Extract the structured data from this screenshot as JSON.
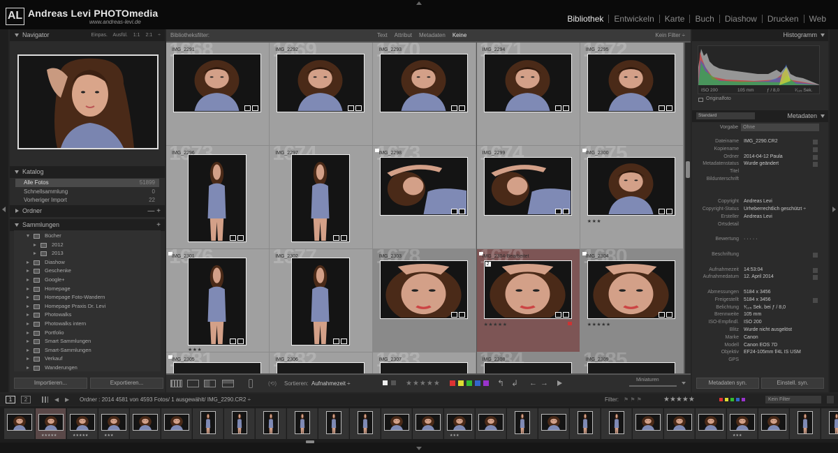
{
  "brand": {
    "logo": "AL",
    "name": "Andreas Levi PHOTOmedia",
    "url": "www.andreas-levi.de"
  },
  "modules": [
    {
      "label": "Bibliothek",
      "active": true
    },
    {
      "label": "Entwickeln"
    },
    {
      "label": "Karte"
    },
    {
      "label": "Buch"
    },
    {
      "label": "Diashow"
    },
    {
      "label": "Drucken"
    },
    {
      "label": "Web"
    }
  ],
  "navigator": {
    "title": "Navigator",
    "options": "Einpas.  Ausfül.  1:1  2:1 ÷"
  },
  "catalog": {
    "title": "Katalog",
    "items": [
      {
        "label": "Alle Fotos",
        "count": "51899"
      },
      {
        "label": "Schnellsammlung",
        "count": "0"
      },
      {
        "label": "Vorheriger Import",
        "count": "22"
      }
    ]
  },
  "folders": {
    "title": "Ordner",
    "actions": "— +"
  },
  "collections": {
    "title": "Sammlungen",
    "plus": "+",
    "items": [
      {
        "label": "Bücher",
        "level": 0,
        "open": true
      },
      {
        "label": "2012",
        "level": 1
      },
      {
        "label": "2013",
        "level": 1
      },
      {
        "label": "Diashow",
        "level": 0
      },
      {
        "label": "Geschenke",
        "level": 0
      },
      {
        "label": "Google+",
        "level": 0
      },
      {
        "label": "Homepage",
        "level": 0
      },
      {
        "label": "Homepage Foto-Wandern",
        "level": 0
      },
      {
        "label": "Homepage Praxis Dr. Levi",
        "level": 0
      },
      {
        "label": "Photowalks",
        "level": 0
      },
      {
        "label": "Photowalks intern",
        "level": 0
      },
      {
        "label": "Portfolio",
        "level": 0
      },
      {
        "label": "Smart Sammlungen",
        "level": 0
      },
      {
        "label": "Smart-Sammlungen",
        "level": 0
      },
      {
        "label": "Verkauf",
        "level": 0
      },
      {
        "label": "Wanderungen",
        "level": 0
      }
    ]
  },
  "left_buttons": {
    "import": "Importieren...",
    "export": "Exportieren..."
  },
  "filterbar": {
    "label": "Bibliotheksfilter:",
    "tabs": [
      {
        "label": "Text"
      },
      {
        "label": "Attribut"
      },
      {
        "label": "Metadaten"
      },
      {
        "label": "Keine",
        "active": true
      }
    ],
    "preset": "Kein Filter ÷"
  },
  "grid": [
    {
      "num": "1668",
      "name": "IMG_2291",
      "orient": "l",
      "flag": false
    },
    {
      "num": "1669",
      "name": "IMG_2292",
      "orient": "l",
      "flag": false
    },
    {
      "num": "1670",
      "name": "IMG_2293",
      "orient": "l",
      "flag": false
    },
    {
      "num": "1671",
      "name": "IMG_2294",
      "orient": "l",
      "flag": false
    },
    {
      "num": "1672",
      "name": "IMG_2295",
      "orient": "l",
      "flag": false
    },
    {
      "num": "1673",
      "name": "IMG_2296",
      "orient": "p",
      "flag": false
    },
    {
      "num": "1674",
      "name": "IMG_2297",
      "orient": "p",
      "flag": false
    },
    {
      "num": "1673",
      "name": "IMG_2298",
      "orient": "l",
      "flag": true
    },
    {
      "num": "1674",
      "name": "IMG_2299",
      "orient": "l",
      "flag": false
    },
    {
      "num": "1675",
      "name": "IMG_2300",
      "orient": "l",
      "flag": true,
      "stars": "★★★"
    },
    {
      "num": "1676",
      "name": "IMG_2301",
      "orient": "p",
      "flag": true,
      "stars": "★★★"
    },
    {
      "num": "1677",
      "name": "IMG_2302",
      "orient": "p",
      "flag": false
    },
    {
      "num": "1678",
      "name": "IMG_2303",
      "orient": "l",
      "flag": false,
      "dim": true
    },
    {
      "num": "1679",
      "name": "IMG_2304-Bearbeitet",
      "orient": "l",
      "flag": true,
      "sel": true,
      "stars": "★★★★★",
      "stack": "2"
    },
    {
      "num": "1680",
      "name": "IMG_2304",
      "orient": "l",
      "flag": true,
      "dim": true,
      "stars": "★★★★★"
    },
    {
      "num": "1681",
      "name": "IMG_2305",
      "orient": "l",
      "flag": true
    },
    {
      "num": "1682",
      "name": "IMG_2306",
      "orient": "l",
      "flag": false
    },
    {
      "num": "1683",
      "name": "IMG_2307",
      "orient": "l",
      "flag": false
    },
    {
      "num": "1684",
      "name": "IMG_2308",
      "orient": "l",
      "flag": false,
      "dim": true
    },
    {
      "num": "1685",
      "name": "IMG_2309",
      "orient": "l",
      "flag": false,
      "dim": true
    }
  ],
  "toolbar": {
    "sort_label": "Sortieren:",
    "sort_value": "Aufnahmezeit ÷",
    "stars": "★★★★★",
    "thumb_label": "Miniaturen",
    "colors": [
      "#d33",
      "#dd3",
      "#3b3",
      "#36c",
      "#93c"
    ]
  },
  "histogram": {
    "title": "Histogramm",
    "iso": "ISO 200",
    "focal": "105 mm",
    "aperture": "ƒ / 8,0",
    "shutter": "¹⁄₁₂₅ Sek.",
    "original": "Originalfoto"
  },
  "metadata": {
    "title": "Metadaten",
    "preset_select": "Standard",
    "preset_label": "Vorgabe",
    "preset_value": "Ohne",
    "rows": [
      {
        "k": "Dateiname",
        "v": "IMG_2290.CR2",
        "sq": true
      },
      {
        "k": "Kopiename",
        "v": "",
        "sq": true
      },
      {
        "k": "Ordner",
        "v": "2014-04-12 Paula",
        "sq": true
      },
      {
        "k": "Metadatenstatus",
        "v": "Wurde geändert",
        "sq": true
      },
      {
        "k": "Titel",
        "v": ""
      },
      {
        "k": "Bildunterschrift",
        "v": ""
      },
      {
        "k": "",
        "v": ""
      },
      {
        "k": "",
        "v": ""
      },
      {
        "k": "Copyright",
        "v": "Andreas Levi"
      },
      {
        "k": "Copyright-Status",
        "v": "Urheberrechtlich geschützt ÷"
      },
      {
        "k": "Ersteller",
        "v": "Andreas Levi"
      },
      {
        "k": "Ortsdetail",
        "v": ""
      },
      {
        "k": "",
        "v": ""
      },
      {
        "k": "Bewertung",
        "v": "·  ·  ·  ·  ·"
      },
      {
        "k": "",
        "v": ""
      },
      {
        "k": "Beschriftung",
        "v": "",
        "sq": true
      },
      {
        "k": "",
        "v": ""
      },
      {
        "k": "Aufnahmezeit",
        "v": "14:53:04",
        "sq": true
      },
      {
        "k": "Aufnahmedatum",
        "v": "12. April 2014",
        "sq": true
      },
      {
        "k": "",
        "v": ""
      },
      {
        "k": "Abmessungen",
        "v": "5184 x 3456"
      },
      {
        "k": "Freigestellt",
        "v": "5184 x 3456",
        "sq": true
      },
      {
        "k": "Belichtung",
        "v": "¹⁄₁₂₅ Sek. bei ƒ / 8,0"
      },
      {
        "k": "Brennweite",
        "v": "105 mm"
      },
      {
        "k": "ISO-Empfindl.",
        "v": "ISO 200"
      },
      {
        "k": "Blitz",
        "v": "Wurde nicht ausgelöst"
      },
      {
        "k": "Marke",
        "v": "Canon"
      },
      {
        "k": "Modell",
        "v": "Canon EOS 7D"
      },
      {
        "k": "Objektiv",
        "v": "EF24-105mm f/4L IS USM"
      },
      {
        "k": "GPS",
        "v": ""
      }
    ]
  },
  "right_buttons": {
    "sync_meta": "Metadaten syn.",
    "sync_settings": "Einstell. syn."
  },
  "statusbar": {
    "view1": "1",
    "view2": "2",
    "path": "Ordner : 2014   4581 von 4593 Fotos/ 1 ausgewählt/ IMG_2290.CR2 ÷",
    "filter": "Filter:",
    "filter_stars": "★★★★★",
    "filter_preset": "Kein Filter"
  },
  "film": [
    {
      "o": "l",
      "m": "1"
    },
    {
      "o": "l",
      "sel": true,
      "st": "★★★★★"
    },
    {
      "o": "l",
      "st": "★★★★★"
    },
    {
      "o": "l",
      "st": "★★★"
    },
    {
      "o": "l"
    },
    {
      "o": "l"
    },
    {
      "o": "p"
    },
    {
      "o": "p"
    },
    {
      "o": "p"
    },
    {
      "o": "p"
    },
    {
      "o": "p"
    },
    {
      "o": "p"
    },
    {
      "o": "l"
    },
    {
      "o": "l"
    },
    {
      "o": "l",
      "st": "★★★"
    },
    {
      "o": "l"
    },
    {
      "o": "p"
    },
    {
      "o": "l"
    },
    {
      "o": "p"
    },
    {
      "o": "p"
    },
    {
      "o": "l"
    },
    {
      "o": "l"
    },
    {
      "o": "l"
    },
    {
      "o": "l",
      "st": "★★★"
    },
    {
      "o": "l"
    },
    {
      "o": "p"
    },
    {
      "o": "p"
    }
  ]
}
